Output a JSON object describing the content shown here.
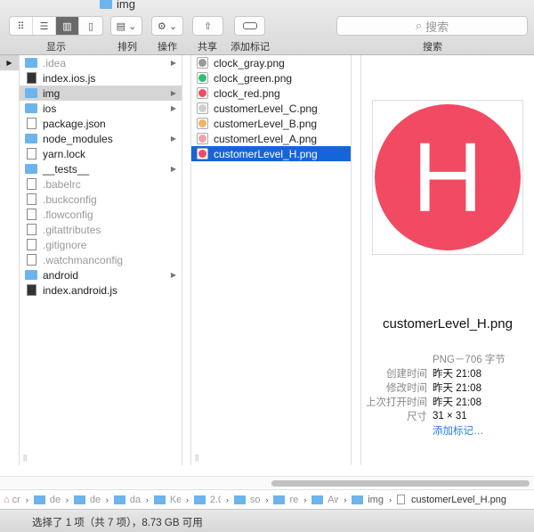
{
  "window": {
    "title": "img"
  },
  "toolbar": {
    "view_label": "显示",
    "arrange_label": "排列",
    "action_label": "操作",
    "share_label": "共享",
    "tag_label": "添加标记",
    "search_placeholder": "搜索",
    "search_label": "搜索"
  },
  "column1": {
    "items": [
      {
        "name": ".idea",
        "type": "folder",
        "dim": true,
        "arrow": true
      },
      {
        "name": "index.ios.js",
        "type": "doc",
        "arrow": false
      },
      {
        "name": "img",
        "type": "folder",
        "arrow": true,
        "selected": true
      },
      {
        "name": "ios",
        "type": "folder",
        "arrow": true
      },
      {
        "name": "package.json",
        "type": "doc",
        "arrow": false
      },
      {
        "name": "node_modules",
        "type": "folder",
        "arrow": true
      },
      {
        "name": "yarn.lock",
        "type": "doc",
        "arrow": false
      },
      {
        "name": "__tests__",
        "type": "folder",
        "arrow": true
      },
      {
        "name": ".babelrc",
        "type": "doc",
        "dim": true
      },
      {
        "name": ".buckconfig",
        "type": "doc",
        "dim": true
      },
      {
        "name": ".flowconfig",
        "type": "doc",
        "dim": true
      },
      {
        "name": ".gitattributes",
        "type": "doc",
        "dim": true
      },
      {
        "name": ".gitignore",
        "type": "doc",
        "dim": true
      },
      {
        "name": ".watchmanconfig",
        "type": "doc",
        "dim": true
      },
      {
        "name": "android",
        "type": "folder",
        "arrow": true
      },
      {
        "name": "index.android.js",
        "type": "doc"
      }
    ]
  },
  "column2": {
    "items": [
      {
        "name": "clock_gray.png",
        "color": "#9a9a9a"
      },
      {
        "name": "clock_green.png",
        "color": "#2fbf71"
      },
      {
        "name": "clock_red.png",
        "color": "#f24a63"
      },
      {
        "name": "customerLevel_C.png",
        "color": "#cfcfcf"
      },
      {
        "name": "customerLevel_B.png",
        "color": "#f5b261"
      },
      {
        "name": "customerLevel_A.png",
        "color": "#f7a0a8"
      },
      {
        "name": "customerLevel_H.png",
        "color": "#f24a63",
        "selected": true
      }
    ]
  },
  "preview": {
    "letter": "H",
    "color": "#f24a63",
    "filename": "customerLevel_H.png",
    "kind": "PNG－706 字节",
    "meta": [
      {
        "k": "创建时间",
        "v": "昨天 21:08"
      },
      {
        "k": "修改时间",
        "v": "昨天 21:08"
      },
      {
        "k": "上次打开时间",
        "v": "昨天 21:08"
      },
      {
        "k": "尺寸",
        "v": "31 × 31"
      }
    ],
    "add_tag": "添加标记…"
  },
  "pathbar": {
    "items": [
      "cr",
      "de",
      "de",
      "da",
      "Ke",
      "2.0",
      "so",
      "re",
      "Aw",
      "img"
    ],
    "file": "customerLevel_H.png"
  },
  "status": "选择了 1 项（共 7 项），8.73 GB 可用"
}
